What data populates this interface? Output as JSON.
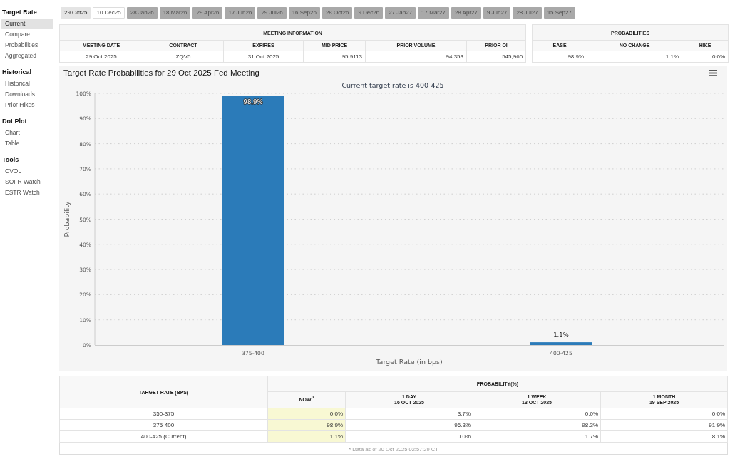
{
  "sidebar": {
    "groups": [
      {
        "heading": "Target Rate",
        "items": [
          {
            "label": "Current",
            "selected": true
          },
          {
            "label": "Compare",
            "selected": false
          },
          {
            "label": "Probabilities",
            "selected": false
          },
          {
            "label": "Aggregated",
            "selected": false
          }
        ]
      },
      {
        "heading": "Historical",
        "items": [
          {
            "label": "Historical",
            "selected": false
          },
          {
            "label": "Downloads",
            "selected": false
          },
          {
            "label": "Prior Hikes",
            "selected": false
          }
        ]
      },
      {
        "heading": "Dot Plot",
        "items": [
          {
            "label": "Chart",
            "selected": false
          },
          {
            "label": "Table",
            "selected": false
          }
        ]
      },
      {
        "heading": "Tools",
        "items": [
          {
            "label": "CVOL",
            "selected": false
          },
          {
            "label": "SOFR Watch",
            "selected": false
          },
          {
            "label": "ESTR Watch",
            "selected": false
          }
        ]
      }
    ]
  },
  "meeting_tabs": [
    {
      "label": "29 Oct25",
      "selected": true,
      "hovered": false
    },
    {
      "label": "10 Dec25",
      "selected": false,
      "hovered": true
    },
    {
      "label": "28 Jan26",
      "selected": false,
      "hovered": false
    },
    {
      "label": "18 Mar26",
      "selected": false,
      "hovered": false
    },
    {
      "label": "29 Apr26",
      "selected": false,
      "hovered": false
    },
    {
      "label": "17 Jun26",
      "selected": false,
      "hovered": false
    },
    {
      "label": "29 Jul26",
      "selected": false,
      "hovered": false
    },
    {
      "label": "16 Sep26",
      "selected": false,
      "hovered": false
    },
    {
      "label": "28 Oct26",
      "selected": false,
      "hovered": false
    },
    {
      "label": "9 Dec26",
      "selected": false,
      "hovered": false
    },
    {
      "label": "27 Jan27",
      "selected": false,
      "hovered": false
    },
    {
      "label": "17 Mar27",
      "selected": false,
      "hovered": false
    },
    {
      "label": "28 Apr27",
      "selected": false,
      "hovered": false
    },
    {
      "label": "9 Jun27",
      "selected": false,
      "hovered": false
    },
    {
      "label": "28 Jul27",
      "selected": false,
      "hovered": false
    },
    {
      "label": "15 Sep27",
      "selected": false,
      "hovered": false
    }
  ],
  "meeting_information": {
    "title": "MEETING INFORMATION",
    "columns": [
      "MEETING DATE",
      "CONTRACT",
      "EXPIRES",
      "MID PRICE",
      "PRIOR VOLUME",
      "PRIOR OI"
    ],
    "row": [
      "29 Oct 2025",
      "ZQV5",
      "31 Oct 2025",
      "95.9113",
      "94,353",
      "545,966"
    ]
  },
  "probabilities": {
    "title": "PROBABILITIES",
    "columns": [
      "EASE",
      "NO CHANGE",
      "HIKE"
    ],
    "row": [
      "98.9%",
      "1.1%",
      "0.0%"
    ]
  },
  "chart": {
    "subtitle": "Current target rate is 400-425",
    "chart_data": {
      "type": "bar",
      "title": "Target Rate Probabilities for 29 Oct 2025 Fed Meeting",
      "xlabel": "Target Rate (in bps)",
      "ylabel": "Probability",
      "categories": [
        "375-400",
        "400-425"
      ],
      "series": [
        {
          "color": "#2b7bb9",
          "values": [
            98.9,
            1.1
          ]
        }
      ],
      "ylim": [
        0,
        100
      ],
      "yticks": [
        {
          "value": 0,
          "label": "0%"
        },
        {
          "value": 10,
          "label": "10%"
        },
        {
          "value": 20,
          "label": "20%"
        },
        {
          "value": 30,
          "label": "30%"
        },
        {
          "value": 40,
          "label": "40%"
        },
        {
          "value": 50,
          "label": "50%"
        },
        {
          "value": 60,
          "label": "60%"
        },
        {
          "value": 70,
          "label": "70%"
        },
        {
          "value": 80,
          "label": "80%"
        },
        {
          "value": 90,
          "label": "90%"
        },
        {
          "value": 100,
          "label": "100%"
        }
      ],
      "grid": true,
      "value_labels": [
        "98.9%",
        "1.1%"
      ]
    }
  },
  "probability_table": {
    "row_header": "TARGET RATE (BPS)",
    "group_header": "PROBABILITY(%)",
    "columns": [
      {
        "label": "NOW $^{*}$",
        "highlighted": true
      },
      {
        "label": "1 DAY",
        "date": "16 OCT 2025",
        "highlighted": false
      },
      {
        "label": "1 WEEK",
        "date": "13 OCT 2025",
        "highlighted": false
      },
      {
        "label": "1 MONTH",
        "date": "19 SEP 2025",
        "highlighted": false
      }
    ],
    "rows": [
      {
        "rate": "350-375",
        "values": [
          "0.0%",
          "3.7%",
          "0.0%",
          "0.0%"
        ]
      },
      {
        "rate": "375-400",
        "values": [
          "98.9%",
          "96.3%",
          "98.3%",
          "91.9%"
        ]
      },
      {
        "rate": "400-425 (Current)",
        "values": [
          "1.1%",
          "0.0%",
          "1.7%",
          "8.1%"
        ]
      }
    ],
    "footnote": "* Data as of 20 Oct 2025 02:57:29 CT"
  }
}
